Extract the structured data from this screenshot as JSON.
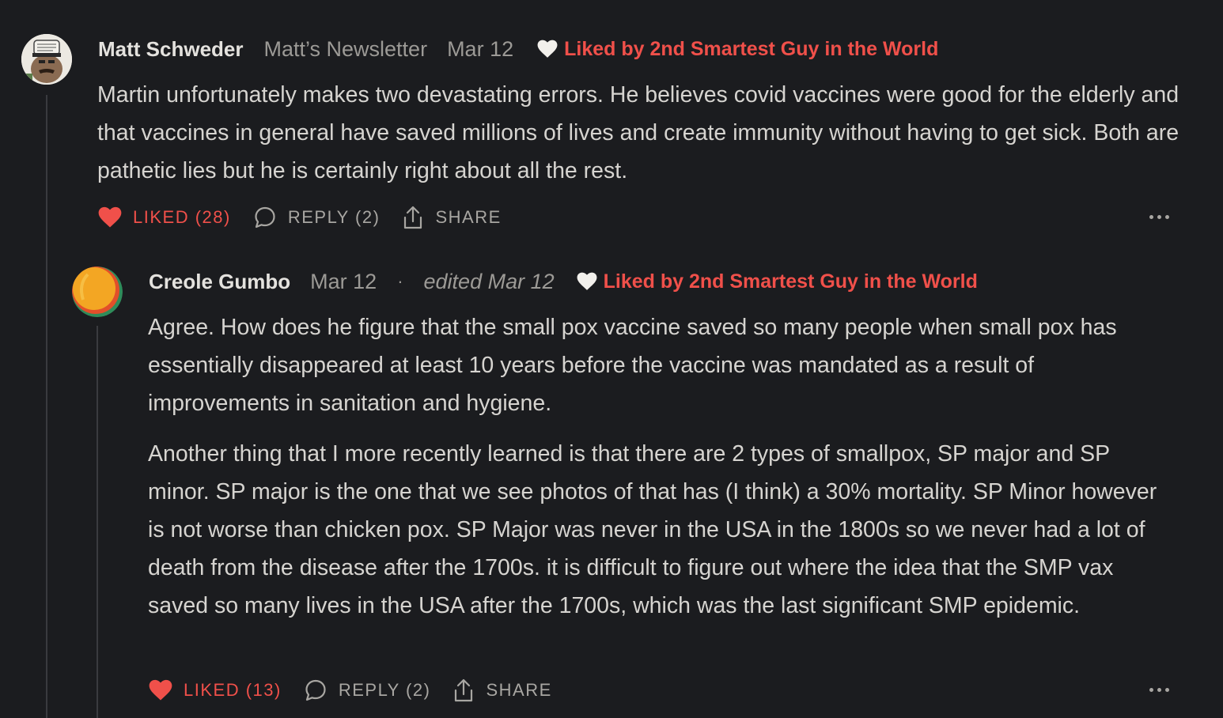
{
  "comments": [
    {
      "author": "Matt Schweder",
      "publication": "Matt’s Newsletter",
      "date": "Mar 12",
      "liked_by": "Liked by 2nd Smartest Guy in the World",
      "body": [
        "Martin unfortunately makes two devastating errors. He believes covid vaccines were good for the elderly and that vaccines in general have saved millions of lives and create immunity without having to get sick. Both are pathetic lies but he is certainly right about all the rest."
      ],
      "actions": {
        "liked": "LIKED (28)",
        "reply": "REPLY (2)",
        "share": "SHARE"
      },
      "avatar_icon": "avatar-photo-icon"
    },
    {
      "author": "Creole Gumbo",
      "date": "Mar 12",
      "separator": "·",
      "edited": "edited Mar 12",
      "liked_by": "Liked by 2nd Smartest Guy in the World",
      "body": [
        "Agree. How does he figure that the small pox vaccine saved so many people when small pox has essentially disappeared at least 10 years before the vaccine was mandated as a result of improvements in sanitation and hygiene.",
        "Another thing that I more recently learned is that there are 2 types of smallpox, SP major and SP minor. SP major is the one that we see photos of that has (I think) a 30% mortality. SP Minor however is not worse than chicken pox. SP Major was never in the USA in the 1800s so we never had a lot of death from the disease after the 1700s. it is difficult to figure out where the idea that the SMP vax saved so many lives in the USA after the 1700s, which was the last significant SMP epidemic."
      ],
      "actions": {
        "liked": "LIKED (13)",
        "reply": "REPLY (2)",
        "share": "SHARE"
      },
      "avatar_icon": "avatar-gradient-icon"
    }
  ],
  "colors": {
    "background": "#1b1c1f",
    "accent_red": "#f0504a",
    "text": "#d6d4d0",
    "muted": "#9c9a96"
  }
}
